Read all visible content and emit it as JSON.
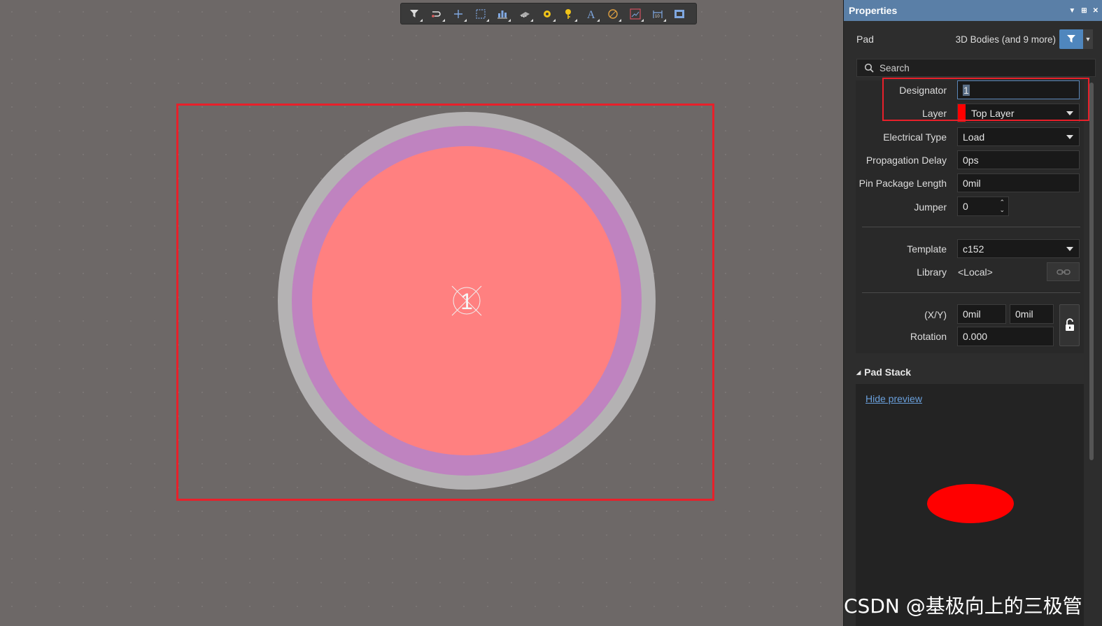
{
  "toolbar": {
    "tools": [
      "filter-icon",
      "route-icon",
      "cross-icon",
      "select-rect-icon",
      "align-icon",
      "component-icon",
      "via-icon",
      "pin-icon",
      "text-icon",
      "arc-icon",
      "graph-icon",
      "dimension-icon",
      "zoom-icon"
    ]
  },
  "colors": {
    "selection_red": "#e8202a",
    "pad_copper": "#ff8080",
    "pad_mask": "#bf83c0",
    "pad_outer": "#b4b2b3",
    "accent": "#4f86bd"
  },
  "canvas": {
    "pad_label": "1"
  },
  "panel": {
    "title": "Properties",
    "object_type": "Pad",
    "selection_summary": "3D Bodies (and 9 more)",
    "search_placeholder": "Search",
    "fields": {
      "designator_label": "Designator",
      "designator_value": "1",
      "layer_label": "Layer",
      "layer_value": "Top Layer",
      "electrical_type_label": "Electrical Type",
      "electrical_type_value": "Load",
      "propagation_delay_label": "Propagation Delay",
      "propagation_delay_value": "0ps",
      "pin_package_length_label": "Pin Package Length",
      "pin_package_length_value": "0mil",
      "jumper_label": "Jumper",
      "jumper_value": "0",
      "template_label": "Template",
      "template_value": "c152",
      "library_label": "Library",
      "library_value": "<Local>",
      "xy_label": "(X/Y)",
      "x_value": "0mil",
      "y_value": "0mil",
      "rotation_label": "Rotation",
      "rotation_value": "0.000"
    },
    "pad_stack": {
      "title": "Pad Stack",
      "hide_preview": "Hide preview"
    }
  },
  "watermark": "CSDN @基极向上的三极管"
}
